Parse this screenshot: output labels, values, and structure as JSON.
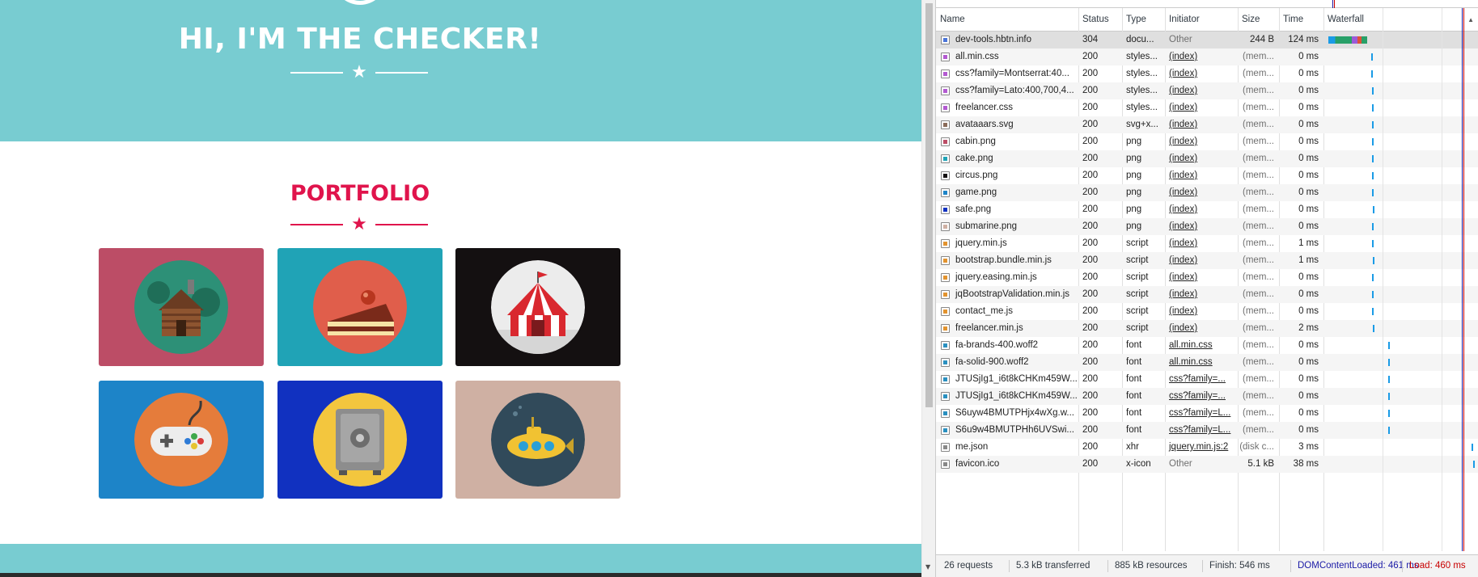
{
  "site": {
    "heading": "HI, I'M THE CHECKER!",
    "portfolio_title": "PORTFOLIO",
    "star_glyph": "★",
    "colors": {
      "masthead": "#78ccd1",
      "accent": "#e0144c"
    },
    "portfolio_items": [
      {
        "name": "cabin",
        "bg": "#bc4d66",
        "circle": "#2d9077"
      },
      {
        "name": "cake",
        "bg": "#20a3b6",
        "circle": "#e05e4b"
      },
      {
        "name": "circus",
        "bg": "#141011",
        "circle": "#ececec"
      },
      {
        "name": "game",
        "bg": "#1d84c8",
        "circle": "#e57c3b"
      },
      {
        "name": "safe",
        "bg": "#1131c0",
        "circle": "#f3c63e"
      },
      {
        "name": "submarine",
        "bg": "#cfb0a3",
        "circle": "#314a5a"
      }
    ]
  },
  "devtools": {
    "columns": [
      "Name",
      "Status",
      "Type",
      "Initiator",
      "Size",
      "Time",
      "Waterfall"
    ],
    "requests": [
      {
        "name": "dev-tools.hbtn.info",
        "status": "304",
        "type": "docu...",
        "initiator": "Other",
        "initiator_link": false,
        "size": "244 B",
        "size_dim": false,
        "time": "124 ms",
        "icon": "document-icon",
        "icon_color": "#4a74d8"
      },
      {
        "name": "all.min.css",
        "status": "200",
        "type": "styles...",
        "initiator": "(index)",
        "initiator_link": true,
        "size": "(mem...",
        "size_dim": true,
        "time": "0 ms",
        "icon": "stylesheet-icon",
        "icon_color": "#b35ad1"
      },
      {
        "name": "css?family=Montserrat:40...",
        "status": "200",
        "type": "styles...",
        "initiator": "(index)",
        "initiator_link": true,
        "size": "(mem...",
        "size_dim": true,
        "time": "0 ms",
        "icon": "stylesheet-icon",
        "icon_color": "#b35ad1"
      },
      {
        "name": "css?family=Lato:400,700,4...",
        "status": "200",
        "type": "styles...",
        "initiator": "(index)",
        "initiator_link": true,
        "size": "(mem...",
        "size_dim": true,
        "time": "0 ms",
        "icon": "stylesheet-icon",
        "icon_color": "#b35ad1"
      },
      {
        "name": "freelancer.css",
        "status": "200",
        "type": "styles...",
        "initiator": "(index)",
        "initiator_link": true,
        "size": "(mem...",
        "size_dim": true,
        "time": "0 ms",
        "icon": "stylesheet-icon",
        "icon_color": "#b35ad1"
      },
      {
        "name": "avataaars.svg",
        "status": "200",
        "type": "svg+x...",
        "initiator": "(index)",
        "initiator_link": true,
        "size": "(mem...",
        "size_dim": true,
        "time": "0 ms",
        "icon": "svg-image-icon",
        "icon_color": "#8a6b5a"
      },
      {
        "name": "cabin.png",
        "status": "200",
        "type": "png",
        "initiator": "(index)",
        "initiator_link": true,
        "size": "(mem...",
        "size_dim": true,
        "time": "0 ms",
        "icon": "image-icon",
        "icon_color": "#bc4d66"
      },
      {
        "name": "cake.png",
        "status": "200",
        "type": "png",
        "initiator": "(index)",
        "initiator_link": true,
        "size": "(mem...",
        "size_dim": true,
        "time": "0 ms",
        "icon": "image-icon",
        "icon_color": "#20a3b6"
      },
      {
        "name": "circus.png",
        "status": "200",
        "type": "png",
        "initiator": "(index)",
        "initiator_link": true,
        "size": "(mem...",
        "size_dim": true,
        "time": "0 ms",
        "icon": "image-icon",
        "icon_color": "#141011"
      },
      {
        "name": "game.png",
        "status": "200",
        "type": "png",
        "initiator": "(index)",
        "initiator_link": true,
        "size": "(mem...",
        "size_dim": true,
        "time": "0 ms",
        "icon": "image-icon",
        "icon_color": "#1d84c8"
      },
      {
        "name": "safe.png",
        "status": "200",
        "type": "png",
        "initiator": "(index)",
        "initiator_link": true,
        "size": "(mem...",
        "size_dim": true,
        "time": "0 ms",
        "icon": "image-icon",
        "icon_color": "#1131c0"
      },
      {
        "name": "submarine.png",
        "status": "200",
        "type": "png",
        "initiator": "(index)",
        "initiator_link": true,
        "size": "(mem...",
        "size_dim": true,
        "time": "0 ms",
        "icon": "image-icon",
        "icon_color": "#cfb0a3"
      },
      {
        "name": "jquery.min.js",
        "status": "200",
        "type": "script",
        "initiator": "(index)",
        "initiator_link": true,
        "size": "(mem...",
        "size_dim": true,
        "time": "1 ms",
        "icon": "script-icon",
        "icon_color": "#e2932f"
      },
      {
        "name": "bootstrap.bundle.min.js",
        "status": "200",
        "type": "script",
        "initiator": "(index)",
        "initiator_link": true,
        "size": "(mem...",
        "size_dim": true,
        "time": "1 ms",
        "icon": "script-icon",
        "icon_color": "#e2932f"
      },
      {
        "name": "jquery.easing.min.js",
        "status": "200",
        "type": "script",
        "initiator": "(index)",
        "initiator_link": true,
        "size": "(mem...",
        "size_dim": true,
        "time": "0 ms",
        "icon": "script-icon",
        "icon_color": "#e2932f"
      },
      {
        "name": "jqBootstrapValidation.min.js",
        "status": "200",
        "type": "script",
        "initiator": "(index)",
        "initiator_link": true,
        "size": "(mem...",
        "size_dim": true,
        "time": "0 ms",
        "icon": "script-icon",
        "icon_color": "#e2932f"
      },
      {
        "name": "contact_me.js",
        "status": "200",
        "type": "script",
        "initiator": "(index)",
        "initiator_link": true,
        "size": "(mem...",
        "size_dim": true,
        "time": "0 ms",
        "icon": "script-icon",
        "icon_color": "#e2932f"
      },
      {
        "name": "freelancer.min.js",
        "status": "200",
        "type": "script",
        "initiator": "(index)",
        "initiator_link": true,
        "size": "(mem...",
        "size_dim": true,
        "time": "2 ms",
        "icon": "script-icon",
        "icon_color": "#e2932f"
      },
      {
        "name": "fa-brands-400.woff2",
        "status": "200",
        "type": "font",
        "initiator": "all.min.css",
        "initiator_link": true,
        "size": "(mem...",
        "size_dim": true,
        "time": "0 ms",
        "icon": "font-icon",
        "icon_color": "#2a90c0"
      },
      {
        "name": "fa-solid-900.woff2",
        "status": "200",
        "type": "font",
        "initiator": "all.min.css",
        "initiator_link": true,
        "size": "(mem...",
        "size_dim": true,
        "time": "0 ms",
        "icon": "font-icon",
        "icon_color": "#2a90c0"
      },
      {
        "name": "JTUSjIg1_i6t8kCHKm459W...",
        "status": "200",
        "type": "font",
        "initiator": "css?family=...",
        "initiator_link": true,
        "size": "(mem...",
        "size_dim": true,
        "time": "0 ms",
        "icon": "font-icon",
        "icon_color": "#2a90c0"
      },
      {
        "name": "JTUSjIg1_i6t8kCHKm459W...",
        "status": "200",
        "type": "font",
        "initiator": "css?family=...",
        "initiator_link": true,
        "size": "(mem...",
        "size_dim": true,
        "time": "0 ms",
        "icon": "font-icon",
        "icon_color": "#2a90c0"
      },
      {
        "name": "S6uyw4BMUTPHjx4wXg.w...",
        "status": "200",
        "type": "font",
        "initiator": "css?family=L...",
        "initiator_link": true,
        "size": "(mem...",
        "size_dim": true,
        "time": "0 ms",
        "icon": "font-icon",
        "icon_color": "#2a90c0"
      },
      {
        "name": "S6u9w4BMUTPHh6UVSwi...",
        "status": "200",
        "type": "font",
        "initiator": "css?family=L...",
        "initiator_link": true,
        "size": "(mem...",
        "size_dim": true,
        "time": "0 ms",
        "icon": "font-icon",
        "icon_color": "#2a90c0"
      },
      {
        "name": "me.json",
        "status": "200",
        "type": "xhr",
        "initiator": "jquery.min.js:2",
        "initiator_link": true,
        "size": "(disk c...",
        "size_dim": true,
        "time": "3 ms",
        "icon": "xhr-icon",
        "icon_color": "#888888"
      },
      {
        "name": "favicon.ico",
        "status": "200",
        "type": "x-icon",
        "initiator": "Other",
        "initiator_link": false,
        "size": "5.1 kB",
        "size_dim": false,
        "time": "38 ms",
        "icon": "other-file-icon",
        "icon_color": "#888888"
      }
    ],
    "summary": {
      "requests": "26 requests",
      "transferred": "5.3 kB transferred",
      "resources": "885 kB resources",
      "finish": "Finish: 546 ms",
      "dom_content_loaded": "DOMContentLoaded: 461 ms",
      "load": "Load: 460 ms"
    },
    "colors": {
      "dom_content_loaded": "#1a1aa6",
      "load": "#c80000",
      "selected_row": "#dfdfdf",
      "waterfall_bar": "#1a9be6"
    }
  }
}
